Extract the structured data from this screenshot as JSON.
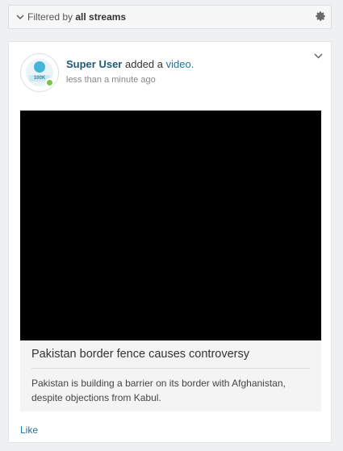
{
  "filter": {
    "prefix": "Filtered by",
    "value": "all streams"
  },
  "post": {
    "actor": "Super User",
    "action_text": "added a",
    "action_link": "video",
    "action_suffix": ".",
    "timestamp": "less than a minute ago",
    "avatar_badge": "100K",
    "video": {
      "title": "Pakistan border fence causes controversy",
      "description": "Pakistan is building a barrier on its border with Afghanistan, despite objections from Kabul."
    },
    "like_label": "Like"
  },
  "colors": {
    "link": "#1f74a6",
    "actor": "#1a5a7a",
    "online": "#7cc242"
  },
  "icons": [
    "chevron-down-icon",
    "gear-icon",
    "online-status-icon"
  ]
}
